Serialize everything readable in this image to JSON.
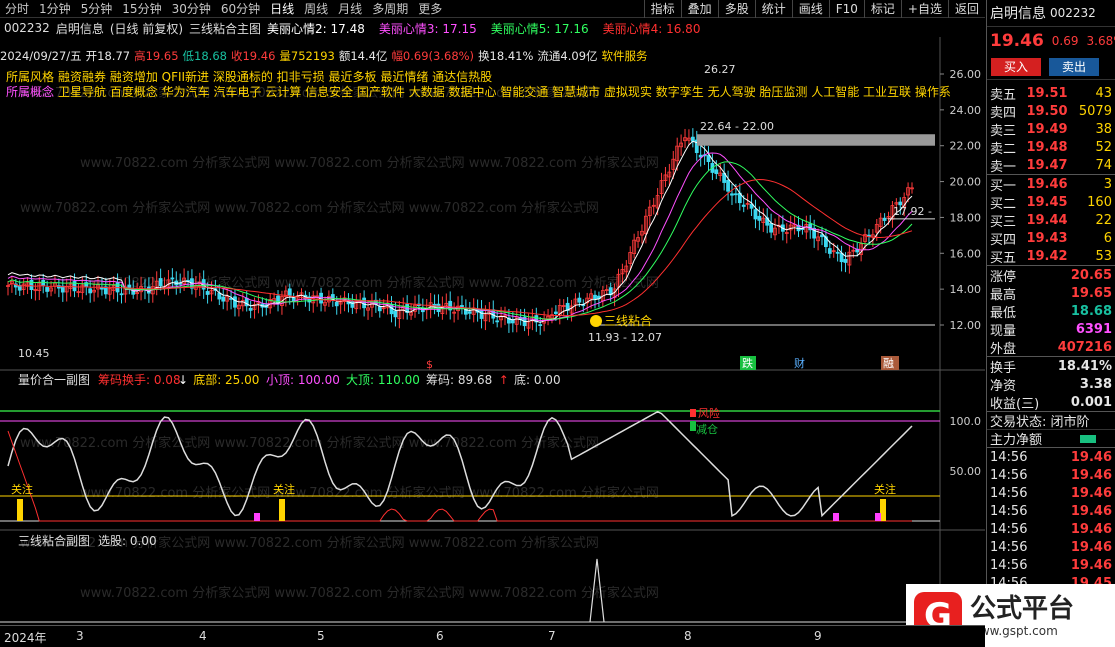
{
  "toolbar": {
    "timeframes": [
      "分时",
      "1分钟",
      "5分钟",
      "15分钟",
      "30分钟",
      "60分钟",
      "日线",
      "周线",
      "月线",
      "多周期",
      "更多"
    ],
    "active_index": 6,
    "right_buttons": [
      "指标",
      "叠加",
      "多股",
      "统计",
      "画线",
      "F10",
      "标记",
      "+自选",
      "返回"
    ]
  },
  "main_title": {
    "code": "002232",
    "name": "启明信息",
    "mode": "(日线 前复权)",
    "indicator": "三线粘合主图",
    "mas": [
      {
        "label": "美丽心情2: 17.48",
        "color": "#ffffff"
      },
      {
        "label": "美丽心情3: 17.15",
        "color": "#ff50ff"
      },
      {
        "label": "美丽心情5: 17.16",
        "color": "#30ff60"
      },
      {
        "label": "美丽心情4: 16.80",
        "color": "#ff3030"
      }
    ]
  },
  "info": {
    "date": "2024/09/27/五",
    "open": "开18.77",
    "high": "高19.65",
    "low": "低18.68",
    "close": "收19.46",
    "vol": "量752193",
    "amount": "额14.4亿",
    "change": "幅0.69(3.68%)",
    "turnover": "换18.41%",
    "float": "流通4.09亿",
    "sector": "软件服务"
  },
  "tags": {
    "style_label": "所属风格",
    "style": "融资融券 融资增加 QFII新进 深股通标的 扣非亏损 最近多板 最近情绪 通达信热股",
    "concept_label": "所属概念",
    "concept": "卫星导航 百度概念 华为汽车 汽车电子 云计算 信息安全 国产软件 大数据 数据中心 智能交通 智慧城市 虚拟现实 数字孪生 无人驾驶 胎压监测 人工智能 工业互联 操作系"
  },
  "main_chart": {
    "y_ticks": [
      "26.00",
      "24.00",
      "22.00",
      "20.00",
      "18.00",
      "16.00",
      "14.00",
      "12.00"
    ],
    "ann_high": "26.27",
    "ann_box": "22.64 - 22.00",
    "ann_low_box": "11.93 - 12.07",
    "ann_low": "10.45",
    "ann_right": "17.92 -",
    "ann_sanxian": "三线粘合",
    "marker_s": "$",
    "marker_die": "跌",
    "marker_cai": "财",
    "marker_hua": "融",
    "watermark": "www.70822.com 分析家公式网"
  },
  "sub1": {
    "name": "量价合一副图",
    "items": [
      {
        "label": "筹码换手: 0.08",
        "color": "#ff3030"
      },
      {
        "label": "↓",
        "color": "#ffffff"
      },
      {
        "label": "底部: 25.00",
        "color": "#ffd400"
      },
      {
        "label": "小顶: 100.00",
        "color": "#ff50ff"
      },
      {
        "label": "大顶: 110.00",
        "color": "#30ff60"
      },
      {
        "label": "筹码: 89.68",
        "color": "#dddddd"
      },
      {
        "label": "↑",
        "color": "#ff3030"
      },
      {
        "label": "底: 0.00",
        "color": "#dddddd"
      }
    ],
    "y_ticks": [
      "100.0",
      "50.00"
    ],
    "labels": [
      "关注",
      "关注",
      "关注"
    ],
    "risk": "风险",
    "reduce": "减仓"
  },
  "sub2": {
    "name": "三线粘合副图",
    "item": "选股: 0.00"
  },
  "x_axis": [
    "2024年",
    "3",
    "4",
    "5",
    "6",
    "7",
    "8",
    "9"
  ],
  "right_panel": {
    "name": "启明信息",
    "code": "002232",
    "price": "19.46",
    "change": "0.69",
    "pct": "3.68%",
    "buy_btn": "买入",
    "sell_btn": "卖出",
    "asks": [
      {
        "label": "卖五",
        "price": "19.51",
        "vol": "43"
      },
      {
        "label": "卖四",
        "price": "19.50",
        "vol": "5079"
      },
      {
        "label": "卖三",
        "price": "19.49",
        "vol": "38"
      },
      {
        "label": "卖二",
        "price": "19.48",
        "vol": "52"
      },
      {
        "label": "卖一",
        "price": "19.47",
        "vol": "74"
      }
    ],
    "bids": [
      {
        "label": "买一",
        "price": "19.46",
        "vol": "3"
      },
      {
        "label": "买二",
        "price": "19.45",
        "vol": "160"
      },
      {
        "label": "买三",
        "price": "19.44",
        "vol": "22"
      },
      {
        "label": "买四",
        "price": "19.43",
        "vol": "6"
      },
      {
        "label": "买五",
        "price": "19.42",
        "vol": "53"
      }
    ],
    "stats": [
      {
        "label": "涨停",
        "value": "20.65",
        "color": "#ff3c3c"
      },
      {
        "label": "最高",
        "value": "19.65",
        "color": "#ff3c3c"
      },
      {
        "label": "最低",
        "value": "18.68",
        "color": "#18c0a0"
      },
      {
        "label": "现量",
        "value": "6391",
        "color": "#ff50ff"
      },
      {
        "label": "外盘",
        "value": "407216",
        "color": "#ff3c3c"
      }
    ],
    "stats2": [
      {
        "label": "换手",
        "value": "18.41%"
      },
      {
        "label": "净资",
        "value": "3.38"
      },
      {
        "label": "收益(三)",
        "value": "0.001"
      }
    ],
    "trade_status": "交易状态: 闭市阶",
    "main_flow": "主力净额",
    "ticks": [
      {
        "time": "14:56",
        "price": "19.46"
      },
      {
        "time": "14:56",
        "price": "19.46"
      },
      {
        "time": "14:56",
        "price": "19.46"
      },
      {
        "time": "14:56",
        "price": "19.46"
      },
      {
        "time": "14:56",
        "price": "19.46"
      },
      {
        "time": "14:56",
        "price": "19.46"
      },
      {
        "time": "14:56",
        "price": "19.46"
      },
      {
        "time": "14:56",
        "price": "19.45"
      }
    ]
  },
  "logo": {
    "mark": "G",
    "title": "公式平台",
    "url": "www.gspt.com"
  }
}
